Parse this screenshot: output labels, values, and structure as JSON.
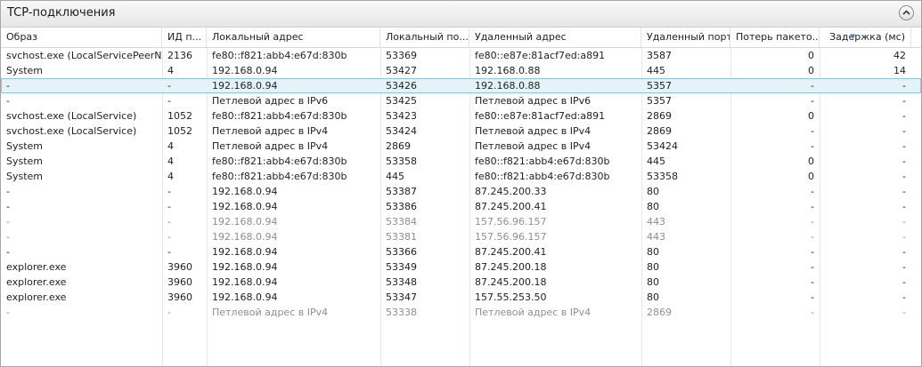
{
  "section": {
    "title": "TCP-подключения",
    "collapse_icon": "chevron-up-icon"
  },
  "columns": [
    "Образ",
    "ИД п...",
    "Локальный адрес",
    "Локальный по...",
    "Удаленный адрес",
    "Удаленный порт",
    "Потерь пакето...",
    "Задержка (мс)"
  ],
  "sorted_column": "Задержка (мс)",
  "rows": [
    {
      "image": "svchost.exe (LocalServicePeerNet)",
      "pid": "2136",
      "local_address": "fe80::f821:abb4:e67d:830b",
      "local_port": "53369",
      "remote_address": "fe80::e87e:81acf7ed:a891",
      "remote_port": "3587",
      "packet_loss": "0",
      "latency": "42",
      "state": "normal"
    },
    {
      "image": "System",
      "pid": "4",
      "local_address": "192.168.0.94",
      "local_port": "53427",
      "remote_address": "192.168.0.88",
      "remote_port": "445",
      "packet_loss": "0",
      "latency": "14",
      "state": "normal"
    },
    {
      "image": "-",
      "pid": "-",
      "local_address": "192.168.0.94",
      "local_port": "53426",
      "remote_address": "192.168.0.88",
      "remote_port": "5357",
      "packet_loss": "-",
      "latency": "-",
      "state": "selected"
    },
    {
      "image": "-",
      "pid": "-",
      "local_address": "Петлевой адрес в IPv6",
      "local_port": "53425",
      "remote_address": "Петлевой адрес в IPv6",
      "remote_port": "5357",
      "packet_loss": "-",
      "latency": "-",
      "state": "normal"
    },
    {
      "image": "svchost.exe (LocalService)",
      "pid": "1052",
      "local_address": "fe80::f821:abb4:e67d:830b",
      "local_port": "53423",
      "remote_address": "fe80::e87e:81acf7ed:a891",
      "remote_port": "2869",
      "packet_loss": "0",
      "latency": "-",
      "state": "normal"
    },
    {
      "image": "svchost.exe (LocalService)",
      "pid": "1052",
      "local_address": "Петлевой адрес в IPv4",
      "local_port": "53424",
      "remote_address": "Петлевой адрес в IPv4",
      "remote_port": "2869",
      "packet_loss": "-",
      "latency": "-",
      "state": "normal"
    },
    {
      "image": "System",
      "pid": "4",
      "local_address": "Петлевой адрес в IPv4",
      "local_port": "2869",
      "remote_address": "Петлевой адрес в IPv4",
      "remote_port": "53424",
      "packet_loss": "-",
      "latency": "-",
      "state": "normal"
    },
    {
      "image": "System",
      "pid": "4",
      "local_address": "fe80::f821:abb4:e67d:830b",
      "local_port": "53358",
      "remote_address": "fe80::f821:abb4:e67d:830b",
      "remote_port": "445",
      "packet_loss": "0",
      "latency": "-",
      "state": "normal"
    },
    {
      "image": "System",
      "pid": "4",
      "local_address": "fe80::f821:abb4:e67d:830b",
      "local_port": "445",
      "remote_address": "fe80::f821:abb4:e67d:830b",
      "remote_port": "53358",
      "packet_loss": "0",
      "latency": "-",
      "state": "normal"
    },
    {
      "image": "-",
      "pid": "-",
      "local_address": "192.168.0.94",
      "local_port": "53387",
      "remote_address": "87.245.200.33",
      "remote_port": "80",
      "packet_loss": "-",
      "latency": "-",
      "state": "normal"
    },
    {
      "image": "-",
      "pid": "-",
      "local_address": "192.168.0.94",
      "local_port": "53386",
      "remote_address": "87.245.200.41",
      "remote_port": "80",
      "packet_loss": "-",
      "latency": "-",
      "state": "normal"
    },
    {
      "image": "-",
      "pid": "-",
      "local_address": "192.168.0.94",
      "local_port": "53384",
      "remote_address": "157.56.96.157",
      "remote_port": "443",
      "packet_loss": "-",
      "latency": "-",
      "state": "stale"
    },
    {
      "image": "-",
      "pid": "-",
      "local_address": "192.168.0.94",
      "local_port": "53381",
      "remote_address": "157.56.96.157",
      "remote_port": "443",
      "packet_loss": "-",
      "latency": "-",
      "state": "stale"
    },
    {
      "image": "-",
      "pid": "-",
      "local_address": "192.168.0.94",
      "local_port": "53366",
      "remote_address": "87.245.200.41",
      "remote_port": "80",
      "packet_loss": "-",
      "latency": "-",
      "state": "normal"
    },
    {
      "image": "explorer.exe",
      "pid": "3960",
      "local_address": "192.168.0.94",
      "local_port": "53349",
      "remote_address": "87.245.200.18",
      "remote_port": "80",
      "packet_loss": "-",
      "latency": "-",
      "state": "normal"
    },
    {
      "image": "explorer.exe",
      "pid": "3960",
      "local_address": "192.168.0.94",
      "local_port": "53348",
      "remote_address": "87.245.200.18",
      "remote_port": "80",
      "packet_loss": "-",
      "latency": "-",
      "state": "normal"
    },
    {
      "image": "explorer.exe",
      "pid": "3960",
      "local_address": "192.168.0.94",
      "local_port": "53347",
      "remote_address": "157.55.253.50",
      "remote_port": "80",
      "packet_loss": "-",
      "latency": "-",
      "state": "normal"
    },
    {
      "image": "-",
      "pid": "-",
      "local_address": "Петлевой адрес в IPv4",
      "local_port": "53338",
      "remote_address": "Петлевой адрес в IPv4",
      "remote_port": "2869",
      "packet_loss": "-",
      "latency": "-",
      "state": "stale"
    }
  ]
}
